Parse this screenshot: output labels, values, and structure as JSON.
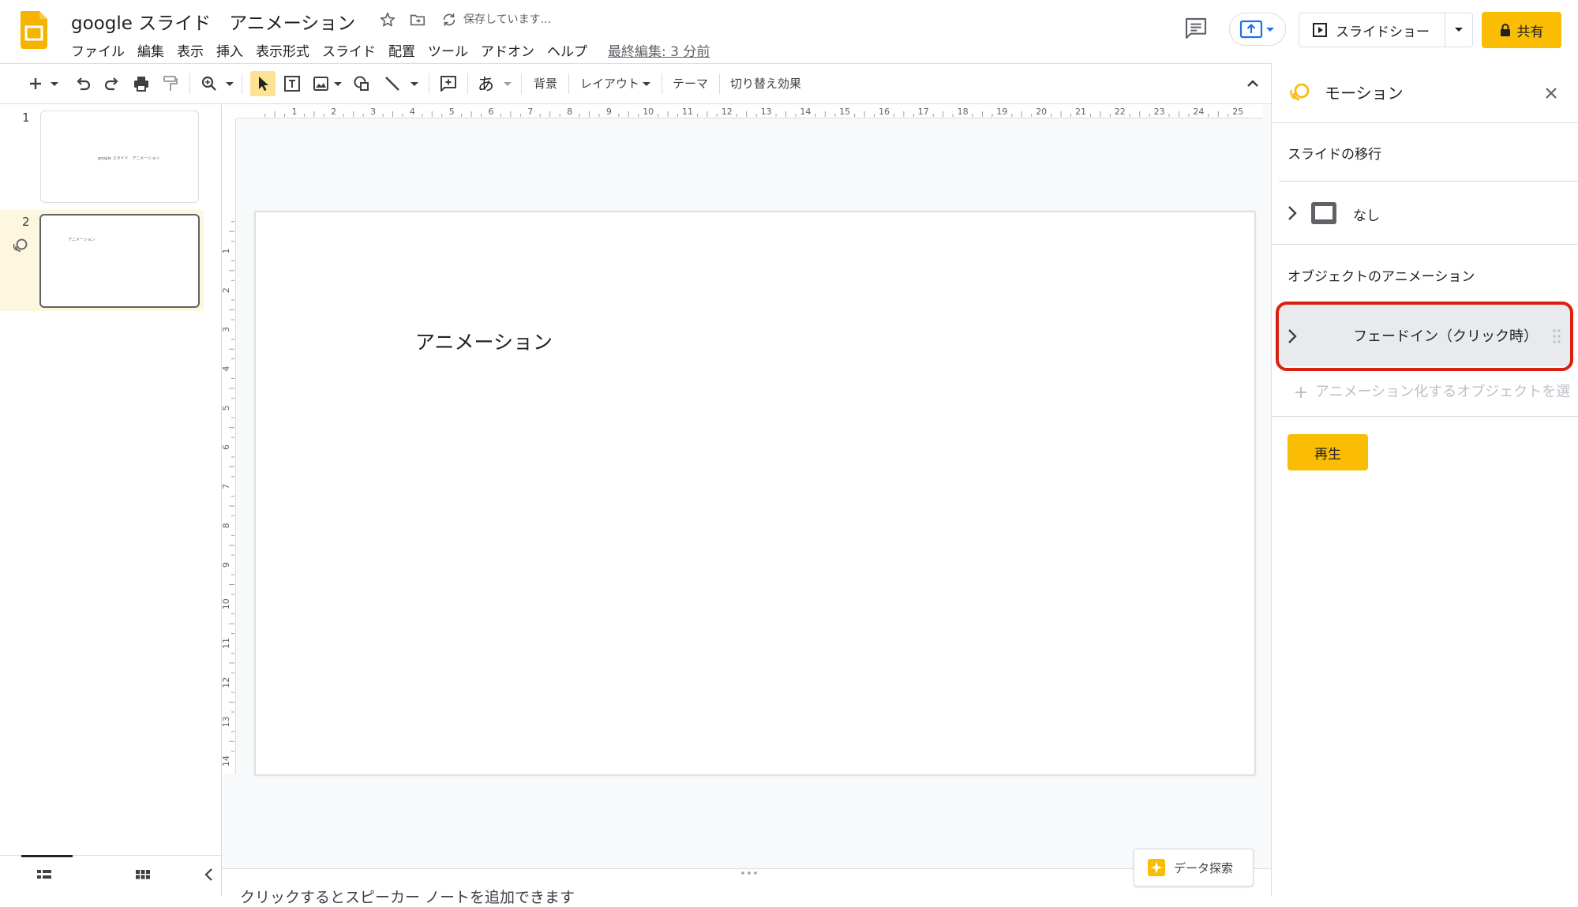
{
  "header": {
    "doc_title": "google スライド　アニメーション",
    "save_status": "保存しています...",
    "menu": [
      "ファイル",
      "編集",
      "表示",
      "挿入",
      "表示形式",
      "スライド",
      "配置",
      "ツール",
      "アドオン",
      "ヘルプ"
    ],
    "last_edit": "最終編集: 3 分前",
    "slideshow_label": "スライドショー",
    "share_label": "共有"
  },
  "toolbar": {
    "ime_glyph": "あ",
    "background_label": "背景",
    "layout_label": "レイアウト",
    "theme_label": "テーマ",
    "transition_label": "切り替え効果"
  },
  "ruler": {
    "h_ticks": [
      "1",
      "2",
      "3",
      "4",
      "5",
      "6",
      "7",
      "8",
      "9",
      "10",
      "11",
      "12",
      "13",
      "14",
      "15",
      "16",
      "17",
      "18",
      "19",
      "20",
      "21",
      "22",
      "23",
      "24",
      "25"
    ],
    "v_ticks": [
      "1",
      "2",
      "3",
      "4",
      "5",
      "6",
      "7",
      "8",
      "9",
      "10",
      "11",
      "12",
      "13",
      "14"
    ]
  },
  "filmstrip": {
    "slides": [
      {
        "number": "1",
        "thumb_text": "google スライド　アニメーション"
      },
      {
        "number": "2",
        "thumb_text": "アニメーション"
      }
    ],
    "selected_slide": 2
  },
  "slide": {
    "text": "アニメーション"
  },
  "notes": {
    "placeholder": "クリックするとスピーカー ノートを追加できます"
  },
  "explore": {
    "label": "データ探索"
  },
  "panel": {
    "title": "モーション",
    "transition_section": "スライドの移行",
    "transition_value": "なし",
    "object_section": "オブジェクトのアニメーション",
    "animation_item": "フェードイン（クリック時）",
    "add_animation": "アニメーション化するオブジェクトを選",
    "play_label": "再生"
  },
  "colors": {
    "accent_yellow": "#fbbc04",
    "highlight_red": "#d8210f",
    "selected_thumb_bg": "#fef7e0"
  }
}
